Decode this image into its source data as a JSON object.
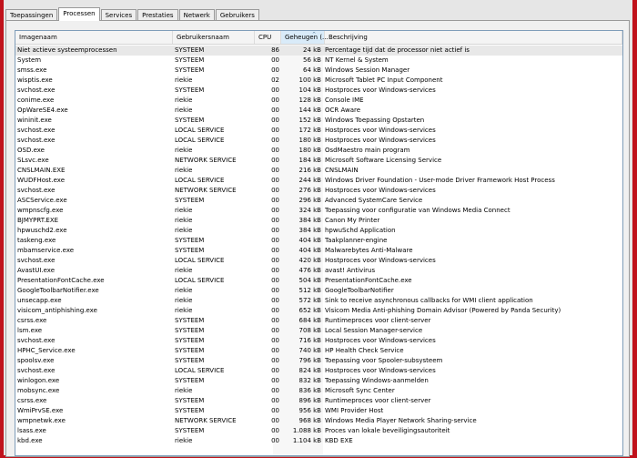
{
  "tabs": [
    "Toepassingen",
    "Processen",
    "Services",
    "Prestaties",
    "Netwerk",
    "Gebruikers"
  ],
  "columns": [
    "Imagenaam",
    "Gebruikersnaam",
    "CPU",
    "Geheugen (...",
    "Beschrijving"
  ],
  "rows": [
    [
      "Niet actieve systeemprocessen",
      "SYSTEEM",
      "86",
      "24 kB",
      "Percentage tijd dat de processor niet actief is"
    ],
    [
      "System",
      "SYSTEEM",
      "00",
      "56 kB",
      "NT Kernel & System"
    ],
    [
      "smss.exe",
      "SYSTEEM",
      "00",
      "64 kB",
      "Windows Session Manager"
    ],
    [
      "wisptis.exe",
      "riekie",
      "02",
      "100 kB",
      "Microsoft Tablet PC Input Component"
    ],
    [
      "svchost.exe",
      "SYSTEEM",
      "00",
      "104 kB",
      "Hostproces voor Windows-services"
    ],
    [
      "conime.exe",
      "riekie",
      "00",
      "128 kB",
      "Console IME"
    ],
    [
      "OpWareSE4.exe",
      "riekie",
      "00",
      "144 kB",
      "OCR Aware"
    ],
    [
      "wininit.exe",
      "SYSTEEM",
      "00",
      "152 kB",
      "Windows Toepassing Opstarten"
    ],
    [
      "svchost.exe",
      "LOCAL SERVICE",
      "00",
      "172 kB",
      "Hostproces voor Windows-services"
    ],
    [
      "svchost.exe",
      "LOCAL SERVICE",
      "00",
      "180 kB",
      "Hostproces voor Windows-services"
    ],
    [
      "OSD.exe",
      "riekie",
      "00",
      "180 kB",
      "OsdMaestro main program"
    ],
    [
      "SLsvc.exe",
      "NETWORK SERVICE",
      "00",
      "184 kB",
      "Microsoft Software Licensing Service"
    ],
    [
      "CNSLMAIN.EXE",
      "riekie",
      "00",
      "216 kB",
      "CNSLMAIN"
    ],
    [
      "WUDFHost.exe",
      "LOCAL SERVICE",
      "00",
      "244 kB",
      "Windows Driver Foundation - User-mode Driver Framework Host Process"
    ],
    [
      "svchost.exe",
      "NETWORK SERVICE",
      "00",
      "276 kB",
      "Hostproces voor Windows-services"
    ],
    [
      "ASCService.exe",
      "SYSTEEM",
      "00",
      "296 kB",
      "Advanced SystemCare Service"
    ],
    [
      "wmpnscfg.exe",
      "riekie",
      "00",
      "324 kB",
      "Toepassing voor configuratie van Windows Media Connect"
    ],
    [
      "BJMYPRT.EXE",
      "riekie",
      "00",
      "384 kB",
      "Canon My Printer"
    ],
    [
      "hpwuschd2.exe",
      "riekie",
      "00",
      "384 kB",
      "hpwuSchd Application"
    ],
    [
      "taskeng.exe",
      "SYSTEEM",
      "00",
      "404 kB",
      "Taakplanner-engine"
    ],
    [
      "mbamservice.exe",
      "SYSTEEM",
      "00",
      "404 kB",
      "Malwarebytes Anti-Malware"
    ],
    [
      "svchost.exe",
      "LOCAL SERVICE",
      "00",
      "420 kB",
      "Hostproces voor Windows-services"
    ],
    [
      "AvastUI.exe",
      "riekie",
      "00",
      "476 kB",
      "avast! Antivirus"
    ],
    [
      "PresentationFontCache.exe",
      "LOCAL SERVICE",
      "00",
      "504 kB",
      "PresentationFontCache.exe"
    ],
    [
      "GoogleToolbarNotifier.exe",
      "riekie",
      "00",
      "512 kB",
      "GoogleToolbarNotifier"
    ],
    [
      "unsecapp.exe",
      "riekie",
      "00",
      "572 kB",
      "Sink to receive asynchronous callbacks for WMI client application"
    ],
    [
      "visicom_antiphishing.exe",
      "riekie",
      "00",
      "652 kB",
      "Visicom Media Anti-phishing Domain Advisor (Powered by Panda Security)"
    ],
    [
      "csrss.exe",
      "SYSTEEM",
      "00",
      "684 kB",
      "Runtimeproces voor client-server"
    ],
    [
      "lsm.exe",
      "SYSTEEM",
      "00",
      "708 kB",
      "Local Session Manager-service"
    ],
    [
      "svchost.exe",
      "SYSTEEM",
      "00",
      "716 kB",
      "Hostproces voor Windows-services"
    ],
    [
      "HPHC_Service.exe",
      "SYSTEEM",
      "00",
      "740 kB",
      "HP Health Check Service"
    ],
    [
      "spoolsv.exe",
      "SYSTEEM",
      "00",
      "796 kB",
      "Toepassing voor Spooler-subsysteem"
    ],
    [
      "svchost.exe",
      "LOCAL SERVICE",
      "00",
      "824 kB",
      "Hostproces voor Windows-services"
    ],
    [
      "winlogon.exe",
      "SYSTEEM",
      "00",
      "832 kB",
      "Toepassing Windows-aanmelden"
    ],
    [
      "mobsync.exe",
      "riekie",
      "00",
      "836 kB",
      "Microsoft Sync Center"
    ],
    [
      "csrss.exe",
      "SYSTEEM",
      "00",
      "896 kB",
      "Runtimeproces voor client-server"
    ],
    [
      "WmiPrvSE.exe",
      "SYSTEEM",
      "00",
      "956 kB",
      "WMI Provider Host"
    ],
    [
      "wmpnetwk.exe",
      "NETWORK SERVICE",
      "00",
      "968 kB",
      "Windows Media Player Network Sharing-service"
    ],
    [
      "lsass.exe",
      "SYSTEEM",
      "00",
      "1.088 kB",
      "Proces van lokale beveiligingsautoriteit"
    ],
    [
      "kbd.exe",
      "riekie",
      "00",
      "1.104 kB",
      "KBD EXE"
    ]
  ]
}
